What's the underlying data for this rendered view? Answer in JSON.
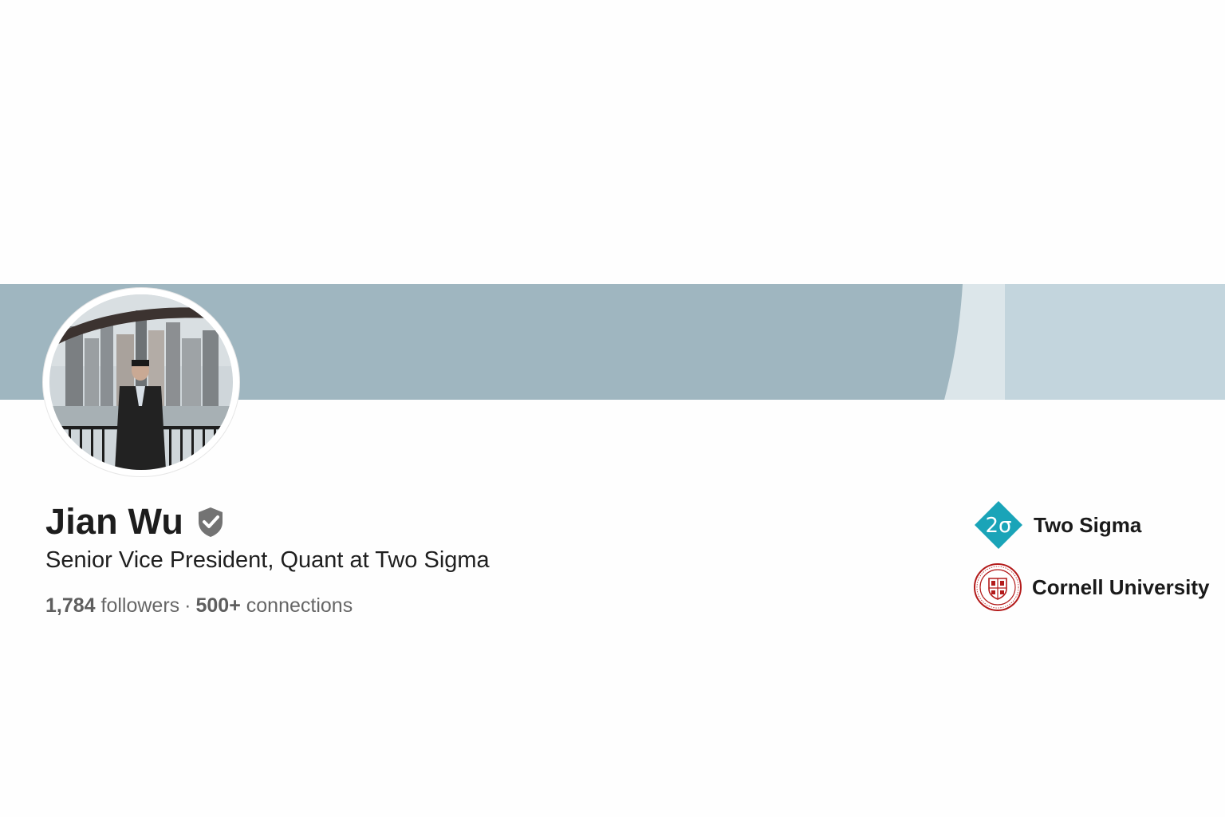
{
  "profile": {
    "name": "Jian Wu",
    "headline": "Senior Vice President, Quant at Two Sigma",
    "followers_count": "1,784",
    "followers_label": "followers",
    "separator": "·",
    "connections_count": "500+",
    "connections_label": "connections"
  },
  "organizations": [
    {
      "name": "Two Sigma",
      "logo_text": "2σ",
      "logo_icon": "two-sigma-logo-icon"
    },
    {
      "name": "Cornell University",
      "logo_icon": "cornell-seal-icon"
    }
  ],
  "icons": {
    "verified": "verified-shield-icon"
  },
  "colors": {
    "banner": "#9fb6c0",
    "banner_light": "#c3d5dd",
    "two_sigma_teal": "#1aa4b8",
    "cornell_red": "#b31b1b",
    "verified_gray": "#737373"
  }
}
